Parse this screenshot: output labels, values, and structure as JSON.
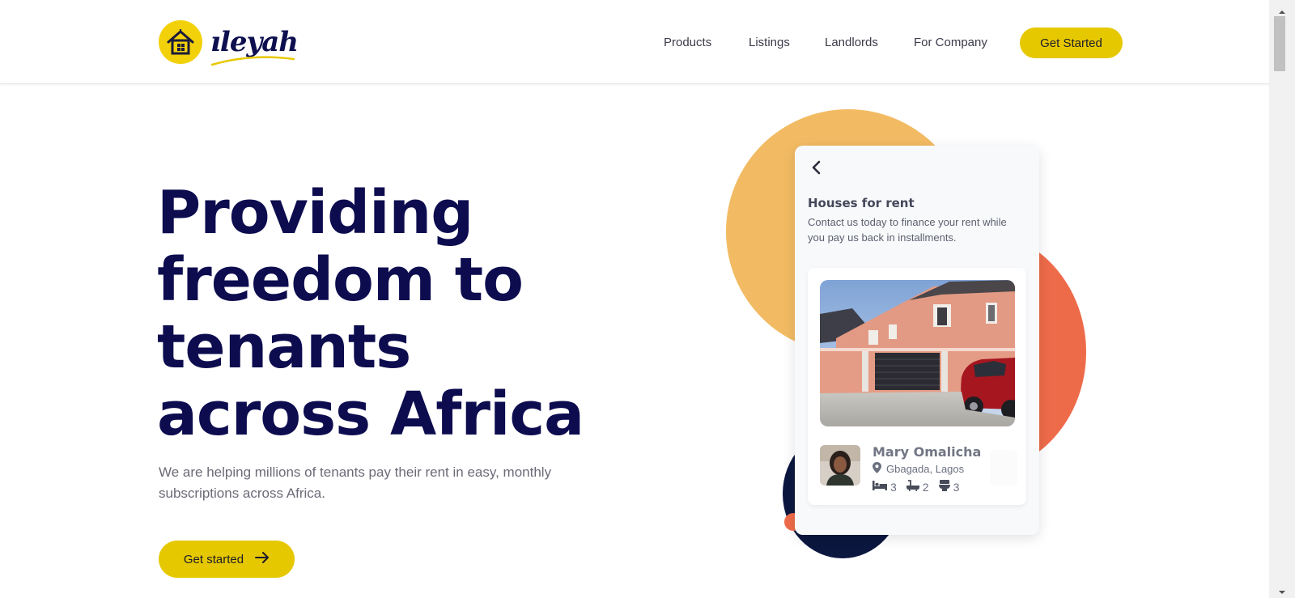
{
  "brand": {
    "name": "ıleyah",
    "logo_icon": "house-icon",
    "accent": "#e6c800",
    "navy": "#0d0c4f"
  },
  "nav": {
    "items": [
      "Products",
      "Listings",
      "Landlords",
      "For Company"
    ],
    "cta": "Get Started"
  },
  "hero": {
    "title_lines": [
      "Providing",
      "freedom to",
      "tenants",
      "across Africa"
    ],
    "subtitle": "We are helping millions of tenants pay their rent in easy, monthly subscriptions across Africa.",
    "cta": "Get started",
    "cta_icon": "arrow-right-icon"
  },
  "card": {
    "back_icon": "chevron-left-icon",
    "title": "Houses for rent",
    "description": "Contact us today to finance your rent while you pay us back in installments.",
    "listing": {
      "photo": "house-photo",
      "agent_name": "Mary Omalicha",
      "location": "Gbagada, Lagos",
      "beds": "3",
      "baths": "2",
      "toilets": "3"
    }
  },
  "colors": {
    "orange_circle": "#f2bb63",
    "red_circle": "#ee6b4a",
    "navy_circle": "#0c1740"
  }
}
